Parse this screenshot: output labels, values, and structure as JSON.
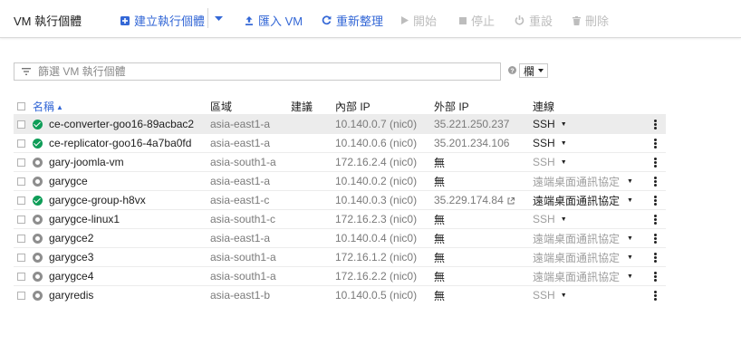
{
  "header": {
    "title": "VM 執行個體",
    "toolbar": {
      "create": "建立執行個體",
      "import": "匯入 VM",
      "refresh": "重新整理",
      "start": "開始",
      "stop": "停止",
      "reset": "重設",
      "delete": "刪除"
    }
  },
  "filter": {
    "placeholder": "篩選 VM 執行個體",
    "columns_button": "欄"
  },
  "table": {
    "headers": {
      "name": "名稱",
      "zone": "區域",
      "recommendation": "建議",
      "internal_ip": "內部 IP",
      "external_ip": "外部 IP",
      "connect": "連線"
    },
    "rows": [
      {
        "name": "ce-converter-goo16-89acbac2",
        "status": "running",
        "zone": "asia-east1-a",
        "internal_ip": "10.140.0.7 (nic0)",
        "external_ip": "35.221.250.237",
        "external_link": false,
        "connect": "SSH",
        "connect_enabled": true,
        "highlighted": true
      },
      {
        "name": "ce-replicator-goo16-4a7ba0fd",
        "status": "running",
        "zone": "asia-east1-a",
        "internal_ip": "10.140.0.6 (nic0)",
        "external_ip": "35.201.234.106",
        "external_link": false,
        "connect": "SSH",
        "connect_enabled": true,
        "highlighted": false
      },
      {
        "name": "gary-joomla-vm",
        "status": "stopped",
        "zone": "asia-south1-a",
        "internal_ip": "172.16.2.4 (nic0)",
        "external_ip": "無",
        "external_link": false,
        "connect": "SSH",
        "connect_enabled": false,
        "highlighted": false
      },
      {
        "name": "garygce",
        "status": "stopped",
        "zone": "asia-east1-a",
        "internal_ip": "10.140.0.2 (nic0)",
        "external_ip": "無",
        "external_link": false,
        "connect": "遠端桌面通訊協定",
        "connect_enabled": false,
        "highlighted": false
      },
      {
        "name": "garygce-group-h8vx",
        "status": "running",
        "zone": "asia-east1-c",
        "internal_ip": "10.140.0.3 (nic0)",
        "external_ip": "35.229.174.84",
        "external_link": true,
        "connect": "遠端桌面通訊協定",
        "connect_enabled": true,
        "highlighted": false
      },
      {
        "name": "garygce-linux1",
        "status": "stopped",
        "zone": "asia-south1-c",
        "internal_ip": "172.16.2.3 (nic0)",
        "external_ip": "無",
        "external_link": false,
        "connect": "SSH",
        "connect_enabled": false,
        "highlighted": false
      },
      {
        "name": "garygce2",
        "status": "stopped",
        "zone": "asia-east1-a",
        "internal_ip": "10.140.0.4 (nic0)",
        "external_ip": "無",
        "external_link": false,
        "connect": "遠端桌面通訊協定",
        "connect_enabled": false,
        "highlighted": false
      },
      {
        "name": "garygce3",
        "status": "stopped",
        "zone": "asia-south1-a",
        "internal_ip": "172.16.1.2 (nic0)",
        "external_ip": "無",
        "external_link": false,
        "connect": "遠端桌面通訊協定",
        "connect_enabled": false,
        "highlighted": false
      },
      {
        "name": "garygce4",
        "status": "stopped",
        "zone": "asia-south1-a",
        "internal_ip": "172.16.2.2 (nic0)",
        "external_ip": "無",
        "external_link": false,
        "connect": "遠端桌面通訊協定",
        "connect_enabled": false,
        "highlighted": false
      },
      {
        "name": "garyredis",
        "status": "stopped",
        "zone": "asia-east1-b",
        "internal_ip": "10.140.0.5 (nic0)",
        "external_ip": "無",
        "external_link": false,
        "connect": "SSH",
        "connect_enabled": false,
        "highlighted": false
      }
    ]
  },
  "icons": {
    "create": "add-box-icon",
    "dropdown": "caret-down-icon",
    "import": "upload-icon",
    "refresh": "refresh-icon",
    "start": "play-icon",
    "stop": "stop-icon",
    "reset": "reset-icon",
    "delete": "trash-icon",
    "filter": "filter-icon",
    "help": "help-icon",
    "running": "running-status-icon",
    "stopped": "stopped-status-icon",
    "external": "external-link-icon",
    "more": "more-vert-icon"
  },
  "colors": {
    "accent": "#3367d6",
    "running": "#0f9d58",
    "stopped": "#8e8e8e",
    "disabled": "#bdbdbd",
    "row_highlight": "#ececec"
  }
}
